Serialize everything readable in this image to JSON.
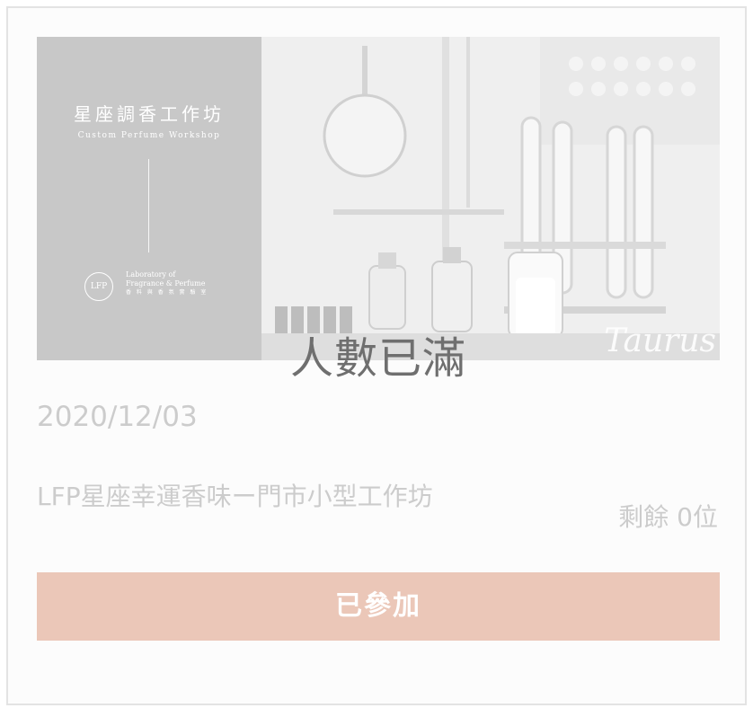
{
  "event": {
    "banner": {
      "title": "星座調香工作坊",
      "subtitle": "Custom Perfume Workshop",
      "logo_text": "LFP",
      "brand_line1": "Laboratory of",
      "brand_line2": "Fragrance & Perfume",
      "brand_line3": "香 料 與 香 氛 實 驗 室",
      "sign_text": "Taurus"
    },
    "status_overlay": "人數已滿",
    "date": "2020/12/03",
    "title": "LFP星座幸運香味ー門市小型工作坊",
    "remaining": "剩餘 0位",
    "join_button": "已參加"
  },
  "colors": {
    "button": "#ebc7b8",
    "muted_text": "#cccccc",
    "overlay_text": "#6f6f6f"
  }
}
